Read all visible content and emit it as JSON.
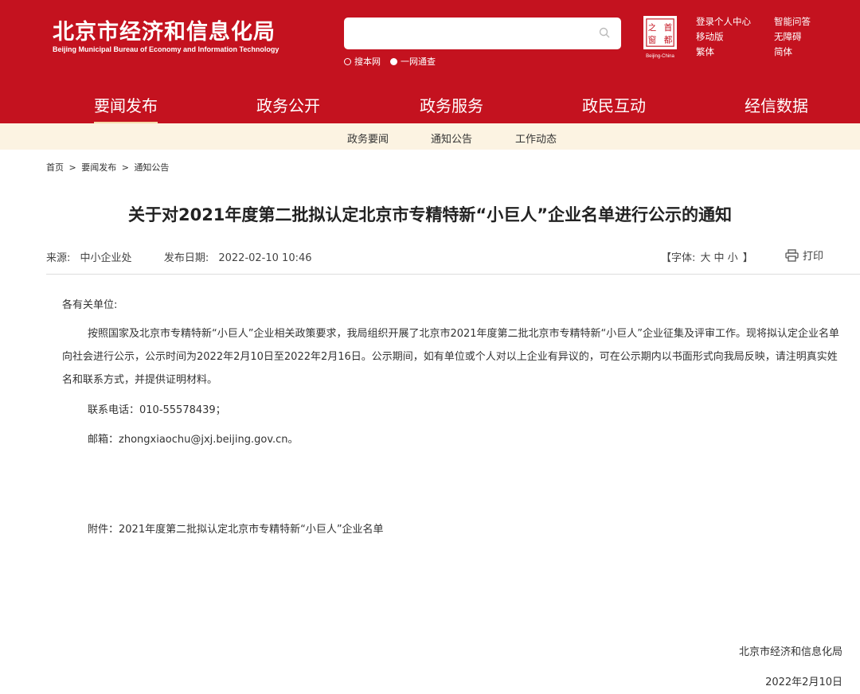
{
  "header": {
    "logo_cn": "北京市经济和信息化局",
    "logo_en": "Beijing Municipal Bureau of Economy and Information Technology",
    "search": {
      "placeholder": "",
      "options": [
        "搜本网",
        "一网通查"
      ],
      "selected": 1
    },
    "seal": {
      "chars": [
        "首",
        "都",
        "之",
        "窗"
      ],
      "caption": "Beijing-China"
    },
    "top_links": [
      "登录个人中心",
      "智能问答",
      "移动版",
      "无障碍",
      "繁体",
      "简体"
    ],
    "colors": {
      "brand_red": "#c4121f",
      "subnav_bg": "#fcf3e2"
    }
  },
  "main_nav": {
    "items": [
      "要闻发布",
      "政务公开",
      "政务服务",
      "政民互动",
      "经信数据"
    ],
    "active": 0
  },
  "sub_nav": {
    "items": [
      "政务要闻",
      "通知公告",
      "工作动态"
    ]
  },
  "breadcrumb": {
    "items": [
      "首页",
      "要闻发布",
      "通知公告"
    ],
    "separator": ">"
  },
  "article": {
    "title": "关于对2021年度第二批拟认定北京市专精特新“小巨人”企业名单进行公示的通知",
    "source_label": "来源:",
    "source": "中小企业处",
    "date_label": "发布日期:",
    "date": "2022-02-10 10:46",
    "font_label_open": "【字体:",
    "font_sizes": [
      "大",
      "中",
      "小"
    ],
    "font_label_close": "】",
    "print_label": "打印",
    "salutation": "各有关单位:",
    "paragraph": "按照国家及北京市专精特新“小巨人”企业相关政策要求，我局组织开展了北京市2021年度第二批北京市专精特新“小巨人”企业征集及评审工作。现将拟认定企业名单向社会进行公示，公示时间为2022年2月10日至2022年2月16日。公示期间，如有单位或个人对以上企业有异议的，可在公示期内以书面形式向我局反映，请注明真实姓名和联系方式，并提供证明材料。",
    "phone": "联系电话：010-55578439；",
    "email": "邮箱：zhongxiaochu@jxj.beijing.gov.cn。",
    "attachment": "附件：2021年度第二批拟认定北京市专精特新“小巨人”企业名单",
    "signer": "北京市经济和信息化局",
    "sign_date": "2022年2月10日"
  }
}
